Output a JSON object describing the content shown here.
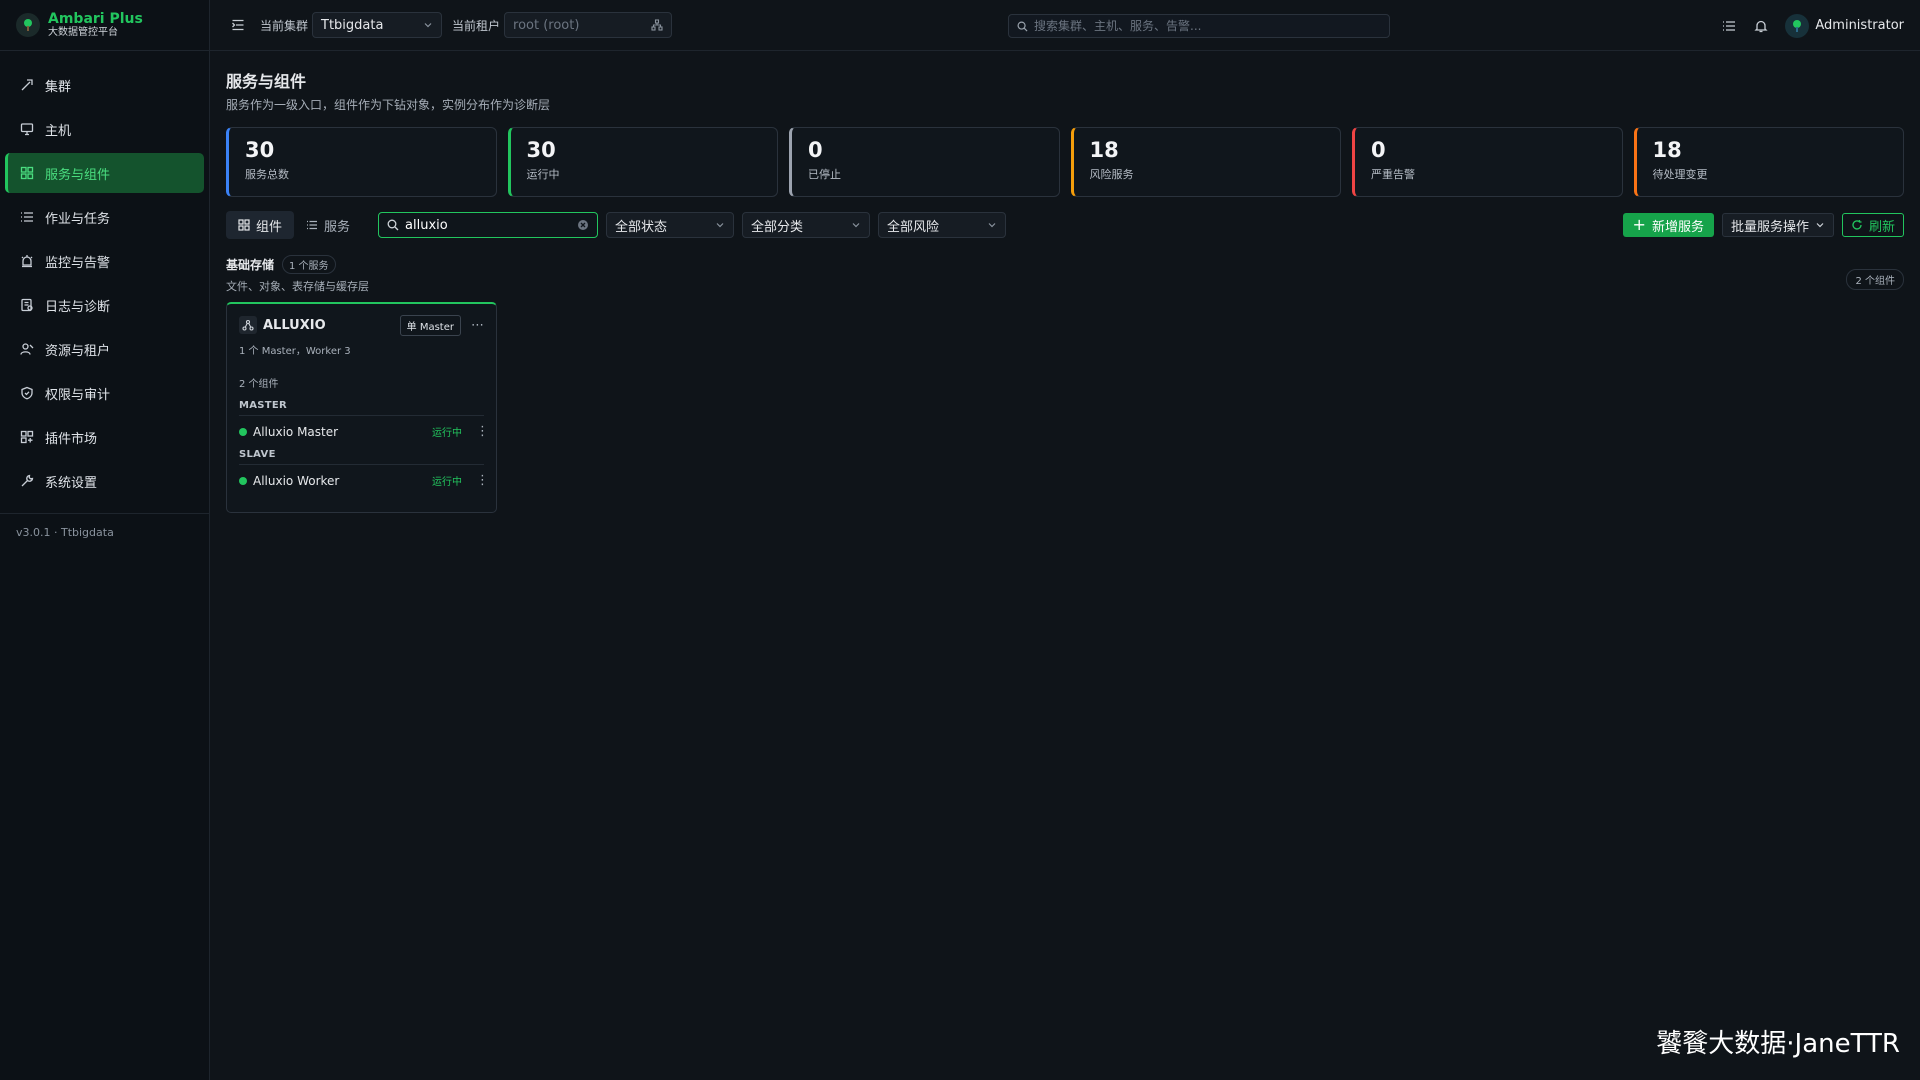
{
  "brand": {
    "name": "Ambari Plus",
    "subtitle": "大数据管控平台"
  },
  "nav": {
    "items": [
      {
        "label": "集群",
        "icon": "rocket-icon"
      },
      {
        "label": "主机",
        "icon": "monitor-icon"
      },
      {
        "label": "服务与组件",
        "icon": "grid-icon",
        "active": true
      },
      {
        "label": "作业与任务",
        "icon": "list-icon"
      },
      {
        "label": "监控与告警",
        "icon": "alarm-icon"
      },
      {
        "label": "日志与诊断",
        "icon": "log-icon"
      },
      {
        "label": "资源与租户",
        "icon": "users-icon"
      },
      {
        "label": "权限与审计",
        "icon": "shield-icon"
      },
      {
        "label": "插件市场",
        "icon": "plugin-icon"
      },
      {
        "label": "系统设置",
        "icon": "wrench-icon"
      }
    ],
    "version": "v3.0.1 · Ttbigdata"
  },
  "topbar": {
    "cluster_label": "当前集群",
    "cluster_value": "Ttbigdata",
    "tenant_label": "当前租户",
    "tenant_placeholder": "root (root)",
    "search_placeholder": "搜索集群、主机、服务、告警...",
    "username": "Administrator"
  },
  "page": {
    "title": "服务与组件",
    "subtitle": "服务作为一级入口，组件作为下钻对象，实例分布作为诊断层"
  },
  "stats": [
    {
      "value": "30",
      "label": "服务总数",
      "color": "#3b82f6"
    },
    {
      "value": "30",
      "label": "运行中",
      "color": "#22c55e"
    },
    {
      "value": "0",
      "label": "已停止",
      "color": "#9ca3af"
    },
    {
      "value": "18",
      "label": "风险服务",
      "color": "#f59e0b"
    },
    {
      "value": "0",
      "label": "严重告警",
      "color": "#ef4444"
    },
    {
      "value": "18",
      "label": "待处理变更",
      "color": "#f97316"
    }
  ],
  "toolbar": {
    "view_components": "组件",
    "view_services": "服务",
    "search_value": "alluxio",
    "status_filter": "全部状态",
    "category_filter": "全部分类",
    "risk_filter": "全部风险",
    "add_service": "新增服务",
    "batch_ops": "批量服务操作",
    "refresh": "刷新"
  },
  "group": {
    "title": "基础存储",
    "service_count": "1 个服务",
    "subtitle": "文件、对象、表存储与缓存层",
    "component_count": "2 个组件"
  },
  "card": {
    "name": "ALLUXIO",
    "badge": "单 Master",
    "meta": "1 个 Master，Worker 3",
    "component_count": "2 个组件",
    "roles": [
      {
        "role": "MASTER",
        "component": "Alluxio Master",
        "status": "运行中"
      },
      {
        "role": "SLAVE",
        "component": "Alluxio Worker",
        "status": "运行中"
      }
    ]
  },
  "watermark": "饕餮大数据·JaneTTR",
  "colors": {
    "accent": "#22c55e",
    "background": "#0f1419"
  }
}
